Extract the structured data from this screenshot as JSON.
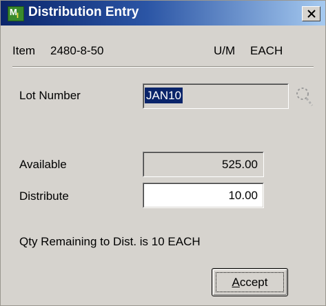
{
  "window": {
    "title": "Distribution Entry",
    "app_icon_letters": "MI"
  },
  "item": {
    "label": "Item",
    "value": "2480-8-50",
    "um_label": "U/M",
    "um_value": "EACH"
  },
  "lot": {
    "label": "Lot Number",
    "value": "JAN10",
    "lookup_icon": "lookup-icon"
  },
  "available": {
    "label": "Available",
    "value": "525.00"
  },
  "distribute": {
    "label": "Distribute",
    "value": "10.00"
  },
  "status": {
    "message": "Qty Remaining to Dist. is 10 EACH"
  },
  "buttons": {
    "accept_mnemonic": "A",
    "accept_rest": "ccept"
  },
  "colors": {
    "titlebar_start": "#0a246a",
    "titlebar_end": "#a6caf0",
    "dialog_bg": "#d6d3ce",
    "selection_bg": "#0a246a"
  }
}
